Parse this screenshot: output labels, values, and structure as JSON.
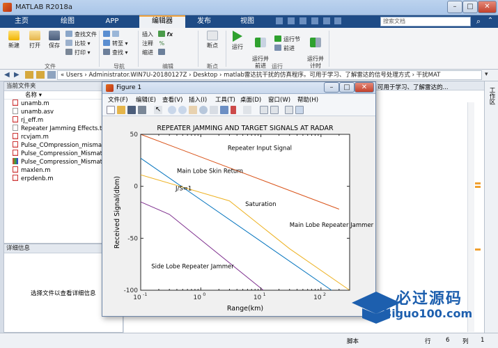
{
  "app": {
    "title": "MATLAB R2018a"
  },
  "window_controls": {
    "minimize": "–",
    "maximize": "□",
    "close": "✕"
  },
  "tabs": [
    "主页",
    "绘图",
    "APP",
    "编辑器",
    "发布",
    "视图"
  ],
  "search": {
    "placeholder": "搜索文档"
  },
  "ribbon": {
    "file_group": {
      "label": "文件",
      "new": "新建",
      "open": "打开",
      "save": "保存",
      "find_files": "查找文件",
      "compare": "比较",
      "print": "打印"
    },
    "nav_group": {
      "label": "导航",
      "goto": "转至",
      "find": "查找"
    },
    "edit_group": {
      "label": "编辑",
      "insert": "插入",
      "comment": "注释",
      "indent": "缩进",
      "fx": "fx"
    },
    "breakpoints_group": {
      "label": "断点",
      "breakpoints": "断点"
    },
    "run_group": {
      "label": "运行",
      "run": "运行",
      "run_advance": "运行并\n前进",
      "run_section": "运行节",
      "advance": "前进",
      "run_time": "运行并\n计时"
    }
  },
  "address": {
    "path": "« Users › Administrator.WIN7U-20180127Z › Desktop › matlab雷达抗干扰的仿真程序。可用于学习、了解雷达的信号处理方式 › 干扰MAT"
  },
  "current_folder": {
    "header": "当前文件夹",
    "column": "名称",
    "files": [
      {
        "name": "unamb.m",
        "type": "m"
      },
      {
        "name": "unamb.asv",
        "type": "asv"
      },
      {
        "name": "rj_eff.m",
        "type": "m"
      },
      {
        "name": "Repeater Jamming Effects.txt",
        "type": "txt"
      },
      {
        "name": "rcvjam.m",
        "type": "m"
      },
      {
        "name": "Pulse_COmpression_mismatch",
        "type": "m"
      },
      {
        "name": "Pulse_Compression_Mismatc",
        "type": "m"
      },
      {
        "name": "Pulse_Compression_Mismatc",
        "type": "fig"
      },
      {
        "name": "maxlen.m",
        "type": "m"
      },
      {
        "name": "erpdenb.m",
        "type": "m"
      }
    ]
  },
  "details": {
    "header": "详细信息",
    "hint": "选择文件以查看详细信息"
  },
  "editor_tail": "可用于学习、了解雷达的...",
  "workspace_label": "工作区",
  "status": {
    "script": "脚本",
    "row_label": "行",
    "row": "6",
    "col_label": "列",
    "col": "1"
  },
  "figure": {
    "title": "Figure 1",
    "menu": [
      "文件(F)",
      "编辑(E)",
      "查看(V)",
      "插入(I)",
      "工具(T)",
      "桌面(D)",
      "窗口(W)",
      "帮助(H)"
    ]
  },
  "chart_data": {
    "type": "line",
    "title": "REPEATER JAMMING AND TARGET SIGNALS AT RADAR",
    "xlabel": "Range(km)",
    "ylabel": "Received Signal(dbm)",
    "xscale": "log",
    "xlim": [
      0.1,
      300
    ],
    "ylim": [
      -100,
      50
    ],
    "xticks": [
      {
        "v": 0.1,
        "base": "10",
        "exp": "-1"
      },
      {
        "v": 1,
        "base": "10",
        "exp": "0"
      },
      {
        "v": 10,
        "base": "10",
        "exp": "1"
      },
      {
        "v": 100,
        "base": "10",
        "exp": "2"
      }
    ],
    "yticks": [
      50,
      0,
      -50,
      -100
    ],
    "grid": false,
    "series": [
      {
        "color": "#d95319",
        "points": [
          [
            0.1,
            50
          ],
          [
            200,
            -22
          ]
        ]
      },
      {
        "color": "#0072bd",
        "points": [
          [
            0.1,
            27
          ],
          [
            150,
            -100
          ]
        ]
      },
      {
        "color": "#edb120",
        "points": [
          [
            0.1,
            11
          ],
          [
            3,
            -14
          ],
          [
            30,
            -60
          ],
          [
            300,
            -100
          ]
        ]
      },
      {
        "color": "#7e2f8e",
        "points": [
          [
            0.1,
            -15
          ],
          [
            0.3,
            -27
          ],
          [
            11,
            -100
          ]
        ]
      }
    ],
    "annotations": [
      {
        "text": "Repeater Input Signal",
        "x": 2.8,
        "y": 35
      },
      {
        "text": "Main Lobe Skin Return",
        "x": 0.4,
        "y": 13
      },
      {
        "text": "J/S=1",
        "x": 0.38,
        "y": -4
      },
      {
        "text": "Saturation",
        "x": 5.5,
        "y": -19
      },
      {
        "text": "Main Lobe Repeater Jammer",
        "x": 30,
        "y": -39
      },
      {
        "text": "Side Lobe Repeater Jammer",
        "x": 0.15,
        "y": -79
      }
    ]
  },
  "watermark": {
    "line1": "必过源码",
    "line2": "Biguo100.com"
  }
}
